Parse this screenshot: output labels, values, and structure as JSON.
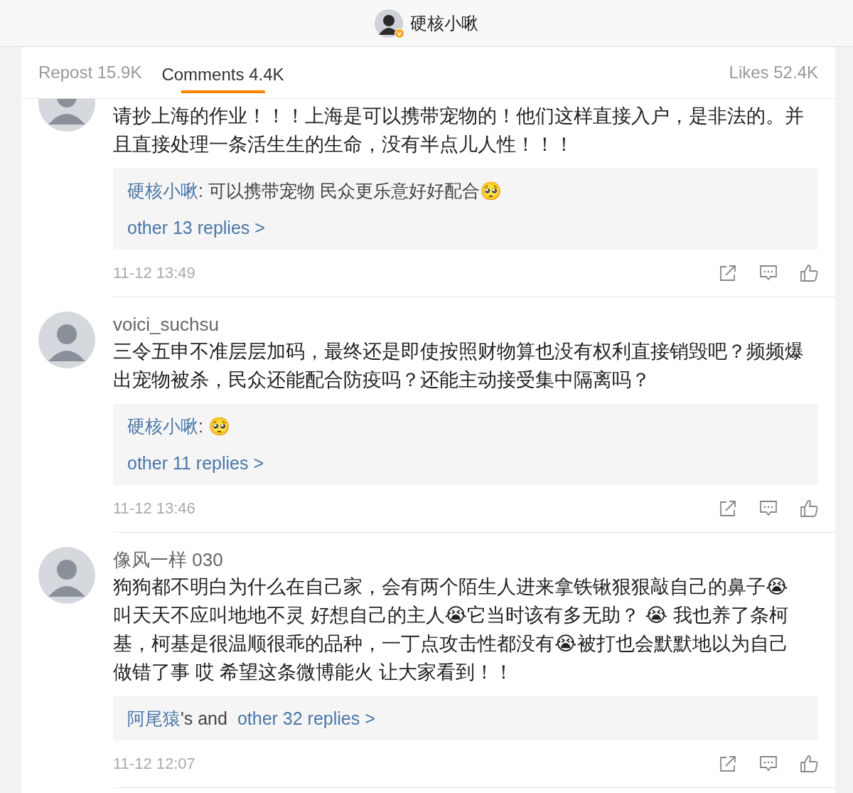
{
  "header": {
    "title": "硬核小啾",
    "verified": true
  },
  "tabs": [
    {
      "label": "Repost 15.9K",
      "selected": false
    },
    {
      "label": "Comments 4.4K",
      "selected": true
    },
    {
      "label": "Likes 52.4K",
      "selected": false
    }
  ],
  "comments": [
    {
      "body": "请抄上海的作业！！！上海是可以携带宠物的！他们这样直接入户，是非法的。并且直接处理一条活生生的生命，没有半点儿人性！！！",
      "replies": {
        "preview": {
          "author": "硬核小啾",
          "text": ": 可以携带宠物 民众更乐意好好配合🥺"
        },
        "more": {
          "label": "other 13 replies >"
        }
      },
      "time": "11-12 13:49"
    },
    {
      "username": "voici_suchsu",
      "body": "三令五申不准层层加码，最终还是即使按照财物算也没有权利直接销毁吧？频频爆出宠物被杀，民众还能配合防疫吗？还能主动接受集中隔离吗？",
      "replies": {
        "preview": {
          "author": "硬核小啾",
          "text": ": 🥺"
        },
        "more": {
          "label": "other 11 replies >"
        }
      },
      "time": "11-12 13:46"
    },
    {
      "username": "像风一样 030",
      "body": "狗狗都不明白为什么在自己家，会有两个陌生人进来拿铁锹狠狠敲自己的鼻子😭叫天天不应叫地地不灵 好想自己的主人😭它当时该有多无助？ 😭 我也养了条柯基，柯基是很温顺很乖的品种，一丁点攻击性都没有😭被打也会默默地以为自己做错了事 哎 希望这条微博能火 让大家看到！！",
      "replies": {
        "more": {
          "author": "阿尾猿",
          "joiner": "'s and",
          "label": "other 32 replies >"
        }
      },
      "time": "11-12 12:07"
    }
  ]
}
